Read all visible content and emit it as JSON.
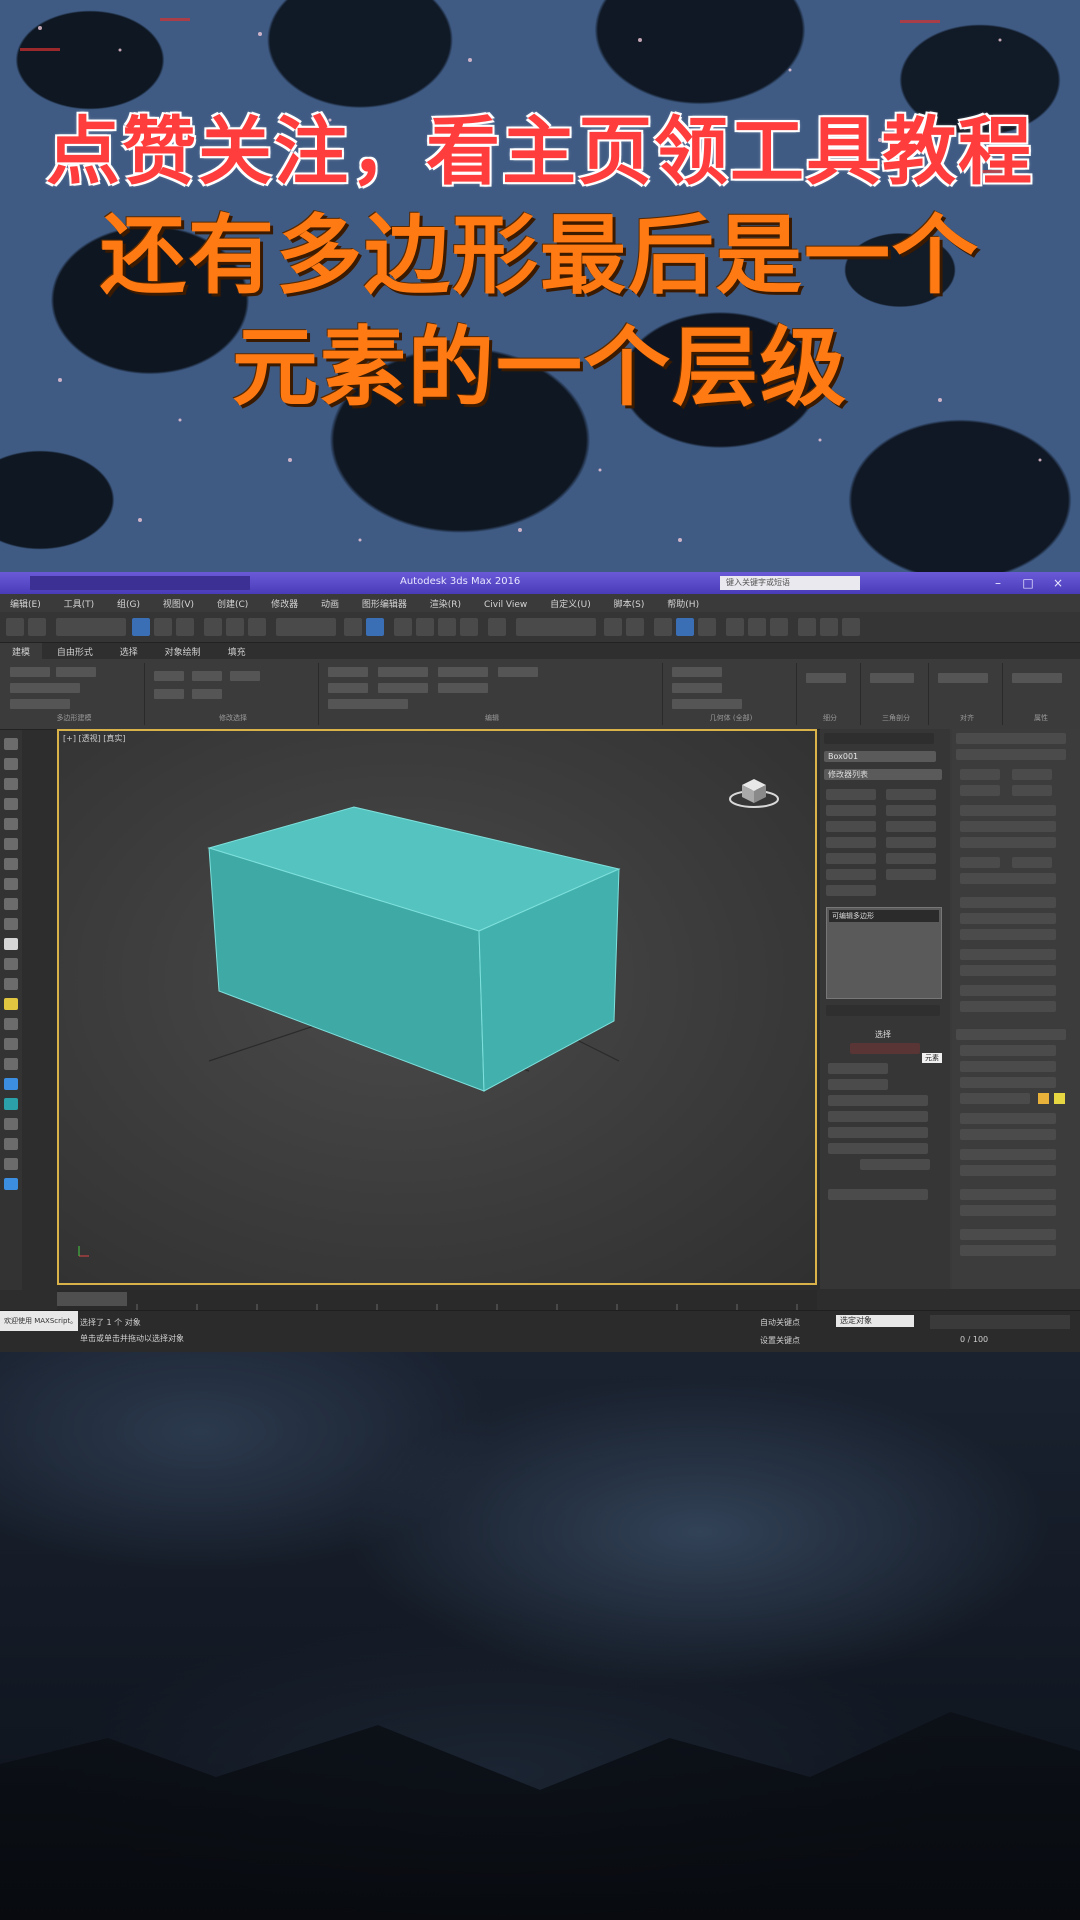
{
  "poster": {
    "headline_1": "点赞关注，看主页领工具教程",
    "headline_2_line1": "还有多边形最后是一个",
    "headline_2_line2": "元素的一个层级",
    "colors": {
      "headline_1": "#ff3d3d",
      "headline_2": "#ff7a12"
    }
  },
  "app": {
    "title": "Autodesk 3ds Max 2016",
    "search_placeholder": "键入关键字或短语",
    "menu": [
      "编辑(E)",
      "工具(T)",
      "组(G)",
      "视图(V)",
      "创建(C)",
      "修改器",
      "动画",
      "图形编辑器",
      "渲染(R)",
      "Civil View",
      "自定义(U)",
      "脚本(S)",
      "帮助(H)"
    ],
    "ribbon_tabs": [
      "建模",
      "自由形式",
      "选择",
      "对象绘制",
      "填充"
    ],
    "ribbon_groups": [
      "多边形建模",
      "修改选择",
      "编辑",
      "几何体 (全部)",
      "细分",
      "三角剖分",
      "对齐",
      "属性"
    ],
    "viewport_label": "[+] [透视] [真实]",
    "box_color": "#44b7b3",
    "command_panel": {
      "object_name": "Box001",
      "modifier_list": "修改器列表",
      "stack_item": "可编辑多边形",
      "selection_title": "选择",
      "tooltip": "元素"
    },
    "status": {
      "selection": "选择了 1 个 对象",
      "prompt": "单击或单击并拖动以选择对象",
      "maxscript": "欢迎使用 MAXScript。",
      "auto_key": "自动关键点",
      "set_key": "设置关键点",
      "selected": "选定对象",
      "frame": "0 / 100"
    }
  }
}
